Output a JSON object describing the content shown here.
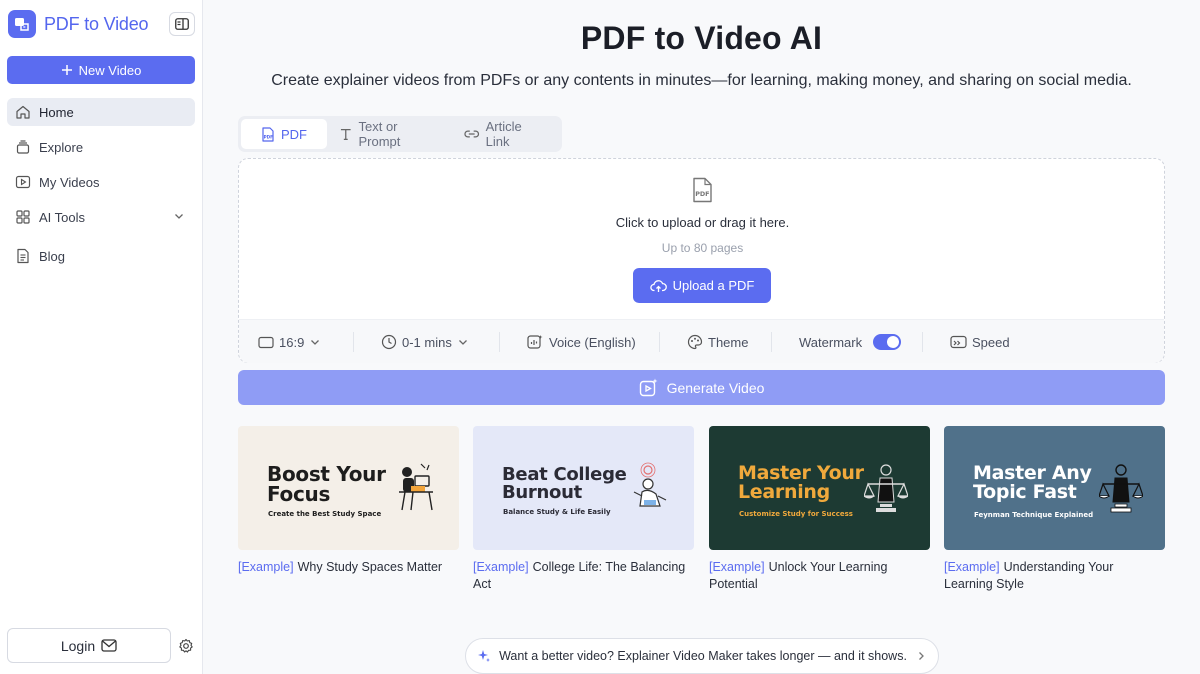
{
  "app": {
    "name": "PDF to Video"
  },
  "sidebar": {
    "new_video_label": "New Video",
    "items": [
      {
        "label": "Home",
        "icon": "home-icon",
        "active": true
      },
      {
        "label": "Explore",
        "icon": "explore-icon"
      },
      {
        "label": "My Videos",
        "icon": "video-icon"
      },
      {
        "label": "AI Tools",
        "icon": "grid-icon",
        "expandable": true
      },
      {
        "label": "Blog",
        "icon": "document-icon"
      }
    ],
    "login_label": "Login"
  },
  "main": {
    "title": "PDF to Video AI",
    "subtitle": "Create explainer videos from PDFs or any contents in minutes—for learning, making money, and sharing on social media.",
    "tabs": [
      {
        "label": "PDF",
        "active": true
      },
      {
        "label": "Text or Prompt"
      },
      {
        "label": "Article Link"
      }
    ],
    "upload": {
      "prompt": "Click to upload or drag it here.",
      "limit": "Up to 80 pages",
      "button_label": "Upload a PDF"
    },
    "options": {
      "aspect": "16:9",
      "duration": "0-1 mins",
      "voice": "Voice (English)",
      "theme": "Theme",
      "watermark": "Watermark",
      "watermark_on": true,
      "speed": "Speed"
    },
    "generate_label": "Generate Video",
    "examples": [
      {
        "thumb_title_1": "Boost Your",
        "thumb_title_2": "Focus",
        "thumb_sub": "Create the Best Study Space",
        "tag": "[Example]",
        "caption": "Why Study Spaces Matter",
        "bg": "#f4efe8",
        "fg": "#1d1d1d",
        "sub_color": "#1d1d1d"
      },
      {
        "thumb_title_1": "Beat College",
        "thumb_title_2": "Burnout",
        "thumb_sub": "Balance Study & Life Easily",
        "tag": "[Example]",
        "caption": "College Life: The Balancing Act",
        "bg": "#e4e8f8",
        "fg": "#2b2b36",
        "sub_color": "#2b2b36"
      },
      {
        "thumb_title_1": "Master Your",
        "thumb_title_2": "Learning",
        "thumb_sub": "Customize Study for Success",
        "tag": "[Example]",
        "caption": "Unlock Your Learning Potential",
        "bg": "#1d3a33",
        "fg": "#f0a93c",
        "sub_color": "#f0a93c"
      },
      {
        "thumb_title_1": "Master Any",
        "thumb_title_2": "Topic Fast",
        "thumb_sub": "Feynman Technique Explained",
        "tag": "[Example]",
        "caption": "Understanding Your Learning Style",
        "bg": "#50718a",
        "fg": "#ffffff",
        "sub_color": "#ffffff"
      }
    ],
    "banner_text": "Want a better video? Explainer Video Maker takes longer — and it shows."
  },
  "colors": {
    "accent": "#5b6cf0",
    "accent_light": "#8f9cf5"
  }
}
